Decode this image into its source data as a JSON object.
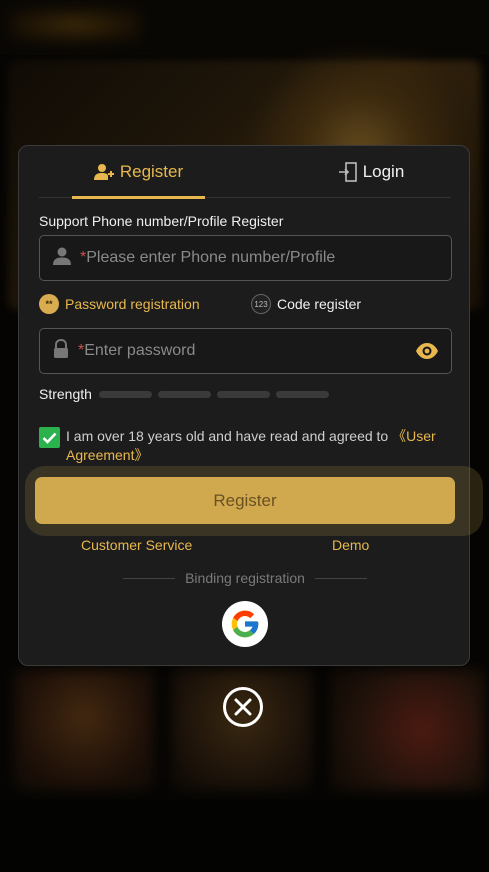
{
  "tabs": {
    "register_label": "Register",
    "login_label": "Login"
  },
  "form": {
    "phone_label": "Support Phone number/Profile Register",
    "phone_required_mark": "*",
    "phone_placeholder": "Please enter Phone number/Profile",
    "method_password_label": "Password registration",
    "method_password_icon_text": "**",
    "method_code_label": "Code register",
    "method_code_icon_text": "123",
    "password_required_mark": "*",
    "password_placeholder": "Enter password",
    "strength_label": "Strength",
    "strength_level": 0,
    "agreement_checked": true,
    "agreement_text": "I am over 18 years old and have read and agreed to ",
    "agreement_link": "《User Agreement》",
    "register_button_label": "Register"
  },
  "links": {
    "customer_service": "Customer Service",
    "demo": "Demo"
  },
  "binding": {
    "label": "Binding registration",
    "providers": [
      "google-icon"
    ]
  },
  "colors": {
    "accent": "#e8b84e",
    "button_bg": "#d0a94f",
    "button_text": "#6a5122",
    "checkbox": "#2bb24c",
    "modal_bg": "#1c1c1c"
  }
}
